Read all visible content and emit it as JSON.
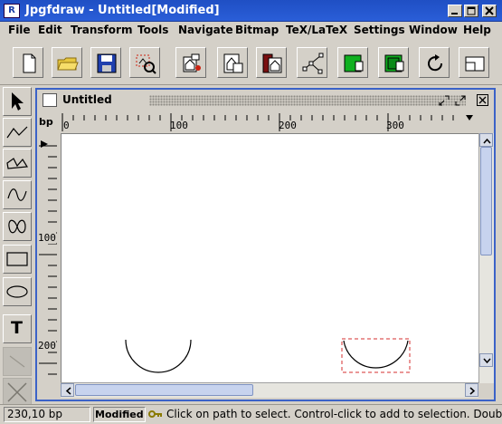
{
  "window": {
    "title": "Jpgfdraw - Untitled[Modified]",
    "icon": "jpgfdraw-app-icon",
    "controls": [
      "minimize-icon",
      "maximize-icon",
      "close-icon"
    ]
  },
  "menu": [
    "File",
    "Edit",
    "Transform",
    "Tools",
    "Navigate",
    "Bitmap",
    "TeX/LaTeX",
    "Settings",
    "Window",
    "Help"
  ],
  "toolbar": {
    "buttons": [
      {
        "name": "new-button",
        "icon": "new-document-icon"
      },
      {
        "name": "open-button",
        "icon": "folder-icon"
      },
      {
        "name": "save-button",
        "icon": "floppy-disk-icon"
      },
      {
        "name": "select-region-button",
        "icon": "select-region-icon"
      },
      {
        "name": "group-button",
        "icon": "group-icon"
      },
      {
        "name": "ungroup-button",
        "icon": "ungroup-icon"
      },
      {
        "name": "move-to-front-button",
        "icon": "front-icon"
      },
      {
        "name": "edit-path-button",
        "icon": "edit-path-icon"
      },
      {
        "name": "fill-color-button",
        "icon": "fill-color-icon"
      },
      {
        "name": "line-color-button",
        "icon": "line-color-icon"
      },
      {
        "name": "redraw-button",
        "icon": "refresh-icon"
      },
      {
        "name": "display-page-button",
        "icon": "page-icon"
      }
    ]
  },
  "tools": [
    {
      "name": "tool-select",
      "icon": "arrow-pointer-icon"
    },
    {
      "name": "tool-open-line",
      "icon": "open-line-icon"
    },
    {
      "name": "tool-closed-line",
      "icon": "closed-line-icon"
    },
    {
      "name": "tool-open-curve",
      "icon": "open-curve-icon"
    },
    {
      "name": "tool-closed-curve",
      "icon": "closed-curve-icon"
    },
    {
      "name": "tool-rectangle",
      "icon": "rectangle-icon"
    },
    {
      "name": "tool-ellipse",
      "icon": "ellipse-icon"
    },
    {
      "name": "tool-text",
      "icon": "text-icon",
      "label": "T"
    },
    {
      "name": "tool-math",
      "icon": "math-mode-icon"
    },
    {
      "name": "tool-none",
      "icon": "none-icon"
    }
  ],
  "document": {
    "title": "Untitled",
    "unit": "bp",
    "h_ruler_labels": [
      "0",
      "100",
      "200",
      "300"
    ],
    "v_ruler_labels": [
      "100",
      "200"
    ],
    "colors": {
      "frame_border": "#3b62c8",
      "selection": "#d62f2f",
      "canvas": "#ffffff"
    }
  },
  "status": {
    "coords": "230,10 bp",
    "modified": "Modified",
    "key_icon": "key-icon",
    "message": "Click on path to select. Control-click to add to selection. Double"
  }
}
